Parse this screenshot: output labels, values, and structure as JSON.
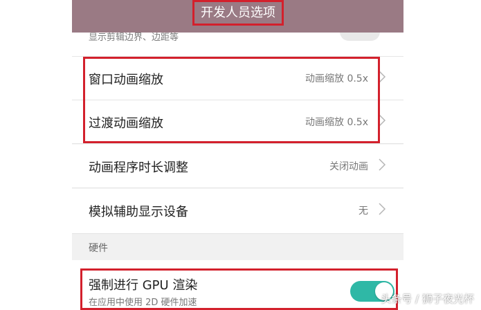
{
  "header": {
    "title": "开发人员选项"
  },
  "partial_row": {
    "text": "显示剪辑边界、边距等"
  },
  "rows": [
    {
      "label": "窗口动画缩放",
      "value": "动画缩放 0.5x"
    },
    {
      "label": "过渡动画缩放",
      "value": "动画缩放 0.5x"
    },
    {
      "label": "动画程序时长调整",
      "value": "关闭动画"
    },
    {
      "label": "模拟辅助显示设备",
      "value": "无"
    }
  ],
  "section": {
    "label": "硬件"
  },
  "gpu": {
    "title": "强制进行 GPU 渲染",
    "subtitle": "在应用中使用 2D 硬件加速",
    "enabled": true
  },
  "watermark": "头条号 / 狮子夜光杯",
  "colors": {
    "header_bg": "#9a7a84",
    "highlight": "#d3202c",
    "toggle_on": "#2fb8a6"
  }
}
